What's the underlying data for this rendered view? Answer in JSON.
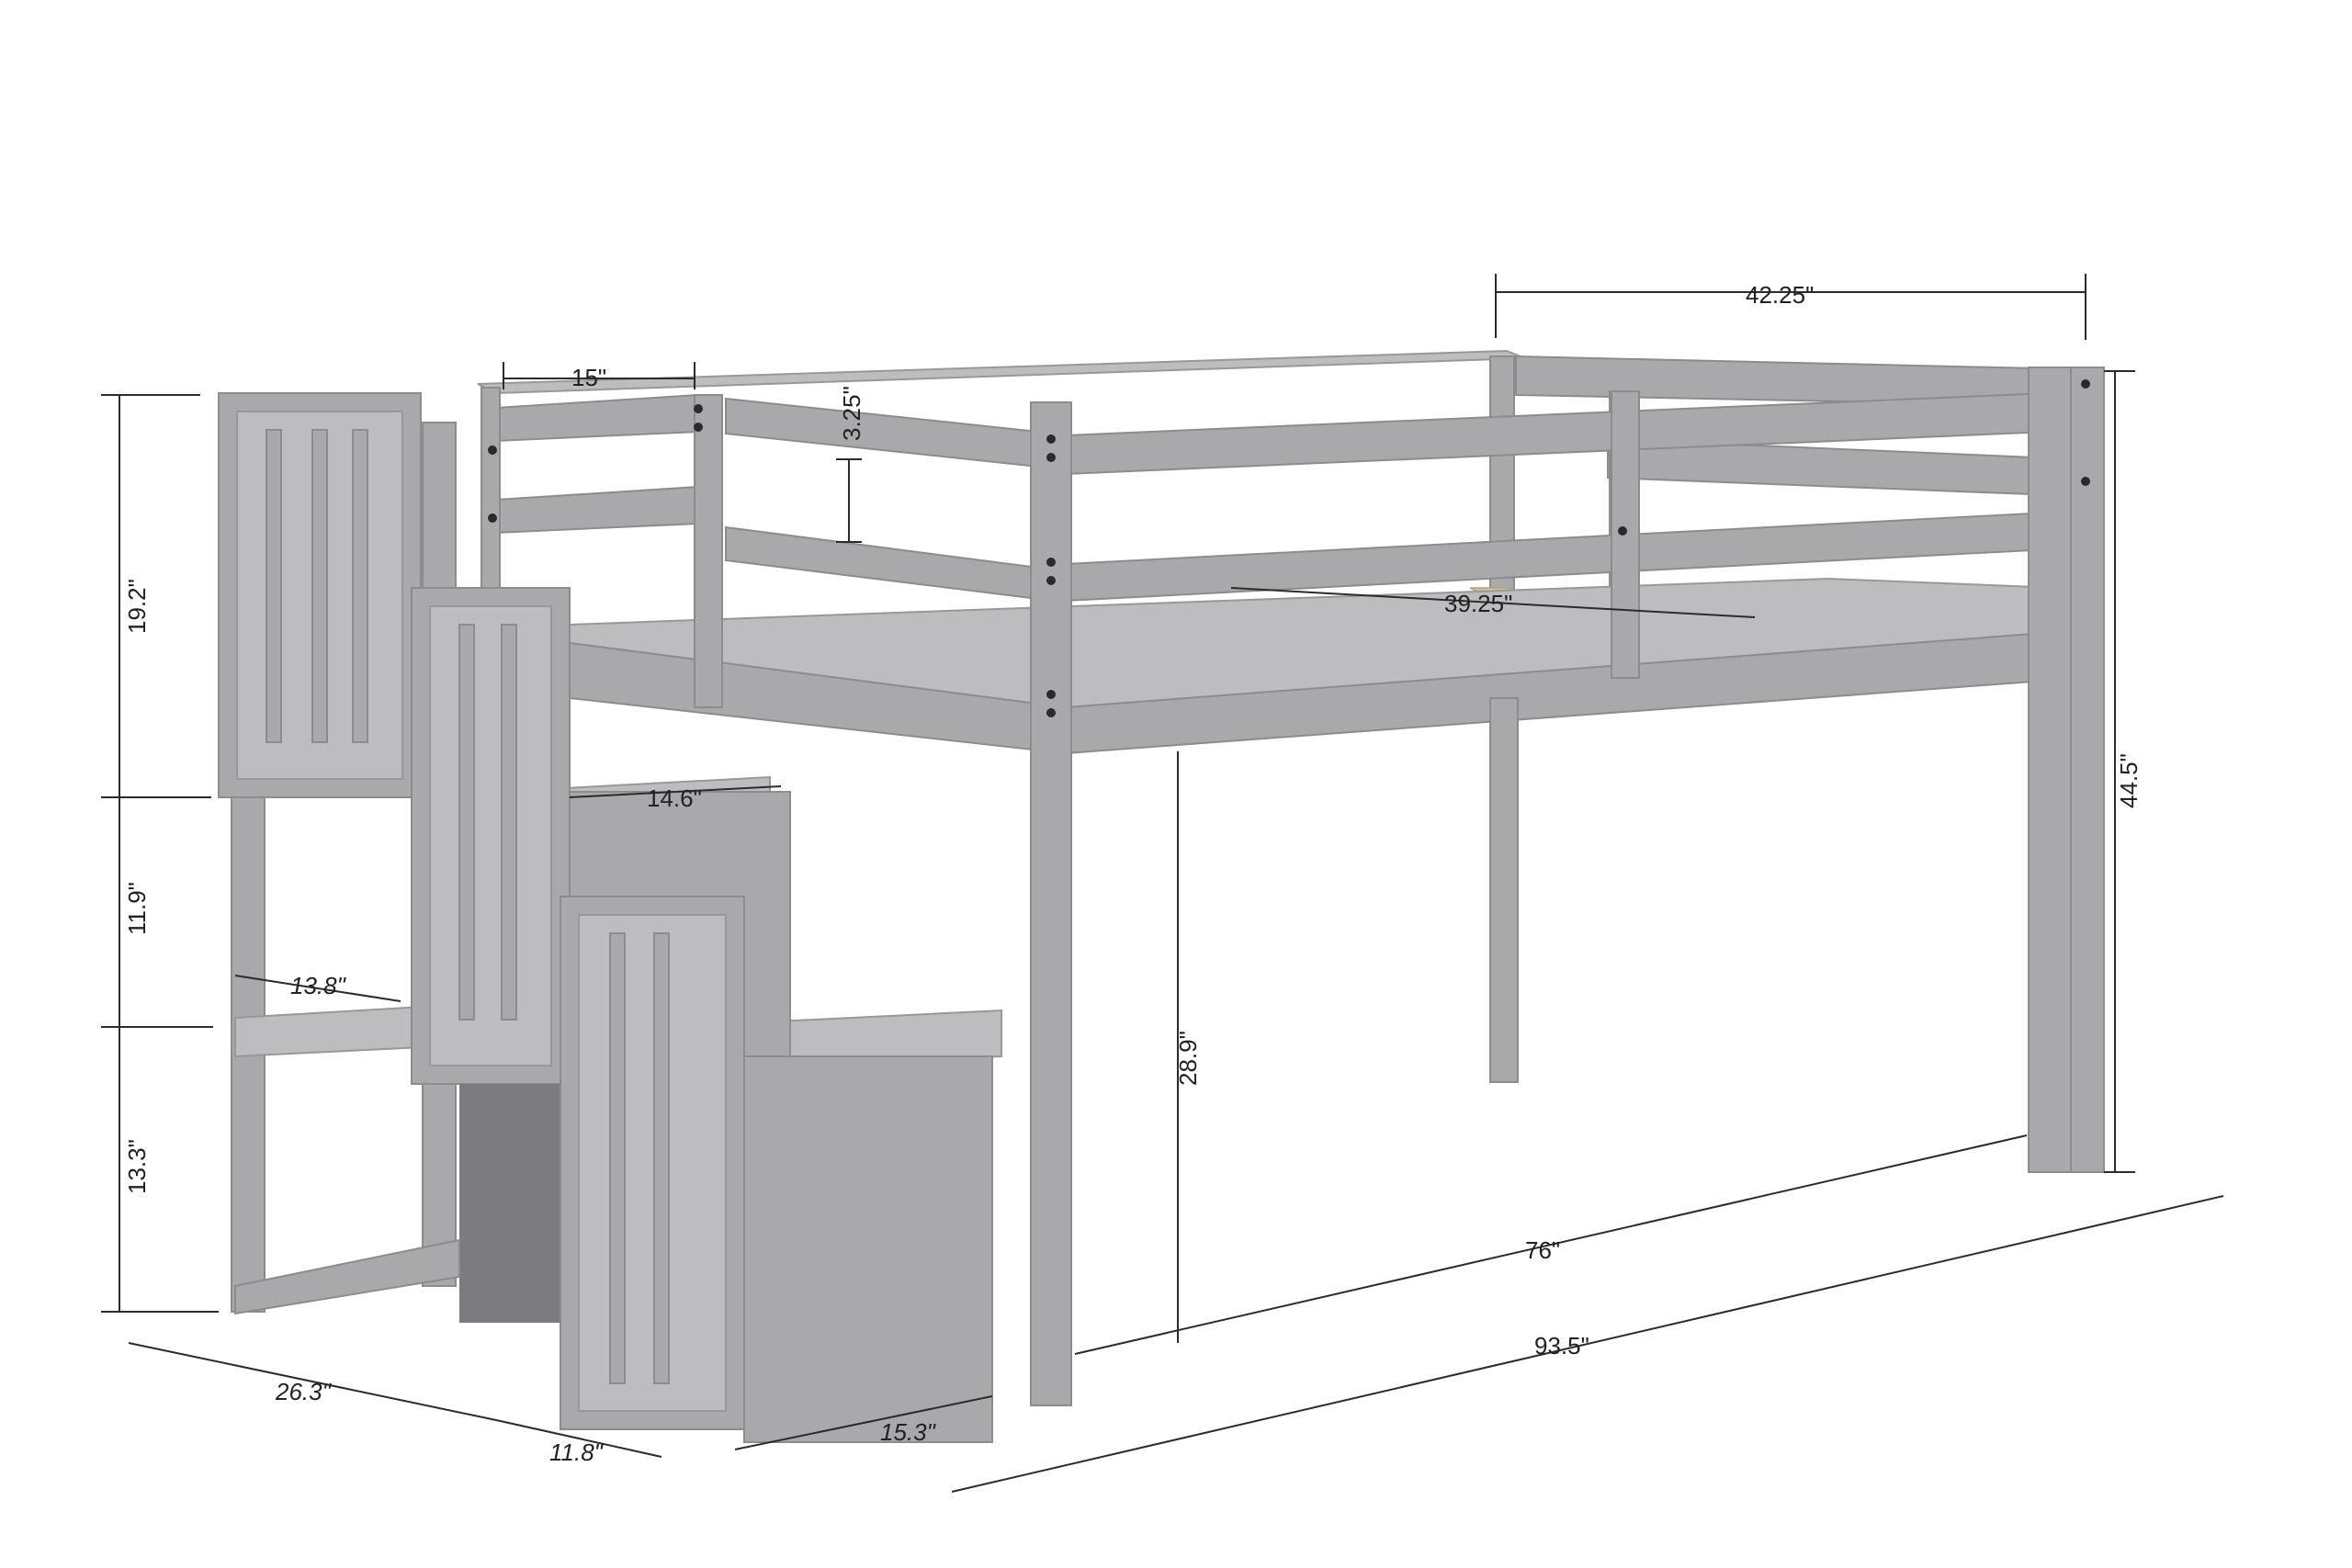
{
  "dimensions": {
    "top_width": "42.25\"",
    "rail_spacing": "15\"",
    "rail_height": "3.25\"",
    "mattress_width": "39.25\"",
    "stair_step_width": "14.6\"",
    "upper_rail_height": "19.2\"",
    "mid_step_height": "11.9\"",
    "lower_step_height": "13.3\"",
    "step_depth": "13.8\"",
    "under_bed_clearance": "28.9\"",
    "total_height": "44.5\"",
    "bed_length": "76\"",
    "total_length": "93.5\"",
    "stair_depth": "26.3\"",
    "step_run": "11.8\"",
    "bottom_step_width": "15.3\""
  },
  "colors": {
    "frame": "#a9a9ab",
    "slats": "#d8c19a",
    "lines": "#2b2b2b"
  }
}
